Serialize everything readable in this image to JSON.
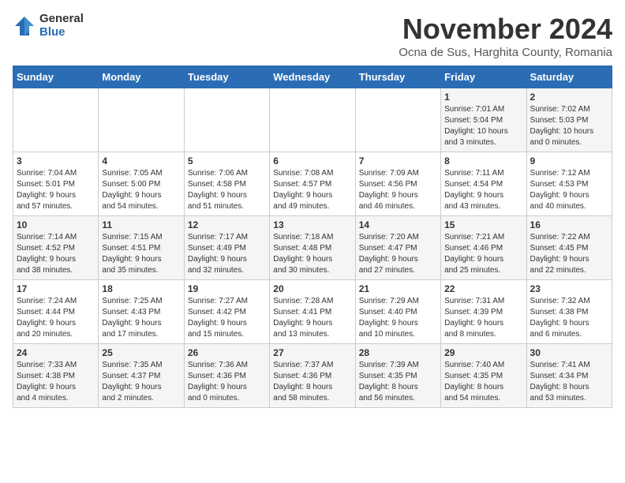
{
  "logo": {
    "general": "General",
    "blue": "Blue"
  },
  "title": "November 2024",
  "subtitle": "Ocna de Sus, Harghita County, Romania",
  "days_of_week": [
    "Sunday",
    "Monday",
    "Tuesday",
    "Wednesday",
    "Thursday",
    "Friday",
    "Saturday"
  ],
  "weeks": [
    [
      {
        "day": "",
        "info": ""
      },
      {
        "day": "",
        "info": ""
      },
      {
        "day": "",
        "info": ""
      },
      {
        "day": "",
        "info": ""
      },
      {
        "day": "",
        "info": ""
      },
      {
        "day": "1",
        "info": "Sunrise: 7:01 AM\nSunset: 5:04 PM\nDaylight: 10 hours\nand 3 minutes."
      },
      {
        "day": "2",
        "info": "Sunrise: 7:02 AM\nSunset: 5:03 PM\nDaylight: 10 hours\nand 0 minutes."
      }
    ],
    [
      {
        "day": "3",
        "info": "Sunrise: 7:04 AM\nSunset: 5:01 PM\nDaylight: 9 hours\nand 57 minutes."
      },
      {
        "day": "4",
        "info": "Sunrise: 7:05 AM\nSunset: 5:00 PM\nDaylight: 9 hours\nand 54 minutes."
      },
      {
        "day": "5",
        "info": "Sunrise: 7:06 AM\nSunset: 4:58 PM\nDaylight: 9 hours\nand 51 minutes."
      },
      {
        "day": "6",
        "info": "Sunrise: 7:08 AM\nSunset: 4:57 PM\nDaylight: 9 hours\nand 49 minutes."
      },
      {
        "day": "7",
        "info": "Sunrise: 7:09 AM\nSunset: 4:56 PM\nDaylight: 9 hours\nand 46 minutes."
      },
      {
        "day": "8",
        "info": "Sunrise: 7:11 AM\nSunset: 4:54 PM\nDaylight: 9 hours\nand 43 minutes."
      },
      {
        "day": "9",
        "info": "Sunrise: 7:12 AM\nSunset: 4:53 PM\nDaylight: 9 hours\nand 40 minutes."
      }
    ],
    [
      {
        "day": "10",
        "info": "Sunrise: 7:14 AM\nSunset: 4:52 PM\nDaylight: 9 hours\nand 38 minutes."
      },
      {
        "day": "11",
        "info": "Sunrise: 7:15 AM\nSunset: 4:51 PM\nDaylight: 9 hours\nand 35 minutes."
      },
      {
        "day": "12",
        "info": "Sunrise: 7:17 AM\nSunset: 4:49 PM\nDaylight: 9 hours\nand 32 minutes."
      },
      {
        "day": "13",
        "info": "Sunrise: 7:18 AM\nSunset: 4:48 PM\nDaylight: 9 hours\nand 30 minutes."
      },
      {
        "day": "14",
        "info": "Sunrise: 7:20 AM\nSunset: 4:47 PM\nDaylight: 9 hours\nand 27 minutes."
      },
      {
        "day": "15",
        "info": "Sunrise: 7:21 AM\nSunset: 4:46 PM\nDaylight: 9 hours\nand 25 minutes."
      },
      {
        "day": "16",
        "info": "Sunrise: 7:22 AM\nSunset: 4:45 PM\nDaylight: 9 hours\nand 22 minutes."
      }
    ],
    [
      {
        "day": "17",
        "info": "Sunrise: 7:24 AM\nSunset: 4:44 PM\nDaylight: 9 hours\nand 20 minutes."
      },
      {
        "day": "18",
        "info": "Sunrise: 7:25 AM\nSunset: 4:43 PM\nDaylight: 9 hours\nand 17 minutes."
      },
      {
        "day": "19",
        "info": "Sunrise: 7:27 AM\nSunset: 4:42 PM\nDaylight: 9 hours\nand 15 minutes."
      },
      {
        "day": "20",
        "info": "Sunrise: 7:28 AM\nSunset: 4:41 PM\nDaylight: 9 hours\nand 13 minutes."
      },
      {
        "day": "21",
        "info": "Sunrise: 7:29 AM\nSunset: 4:40 PM\nDaylight: 9 hours\nand 10 minutes."
      },
      {
        "day": "22",
        "info": "Sunrise: 7:31 AM\nSunset: 4:39 PM\nDaylight: 9 hours\nand 8 minutes."
      },
      {
        "day": "23",
        "info": "Sunrise: 7:32 AM\nSunset: 4:38 PM\nDaylight: 9 hours\nand 6 minutes."
      }
    ],
    [
      {
        "day": "24",
        "info": "Sunrise: 7:33 AM\nSunset: 4:38 PM\nDaylight: 9 hours\nand 4 minutes."
      },
      {
        "day": "25",
        "info": "Sunrise: 7:35 AM\nSunset: 4:37 PM\nDaylight: 9 hours\nand 2 minutes."
      },
      {
        "day": "26",
        "info": "Sunrise: 7:36 AM\nSunset: 4:36 PM\nDaylight: 9 hours\nand 0 minutes."
      },
      {
        "day": "27",
        "info": "Sunrise: 7:37 AM\nSunset: 4:36 PM\nDaylight: 8 hours\nand 58 minutes."
      },
      {
        "day": "28",
        "info": "Sunrise: 7:39 AM\nSunset: 4:35 PM\nDaylight: 8 hours\nand 56 minutes."
      },
      {
        "day": "29",
        "info": "Sunrise: 7:40 AM\nSunset: 4:35 PM\nDaylight: 8 hours\nand 54 minutes."
      },
      {
        "day": "30",
        "info": "Sunrise: 7:41 AM\nSunset: 4:34 PM\nDaylight: 8 hours\nand 53 minutes."
      }
    ]
  ]
}
